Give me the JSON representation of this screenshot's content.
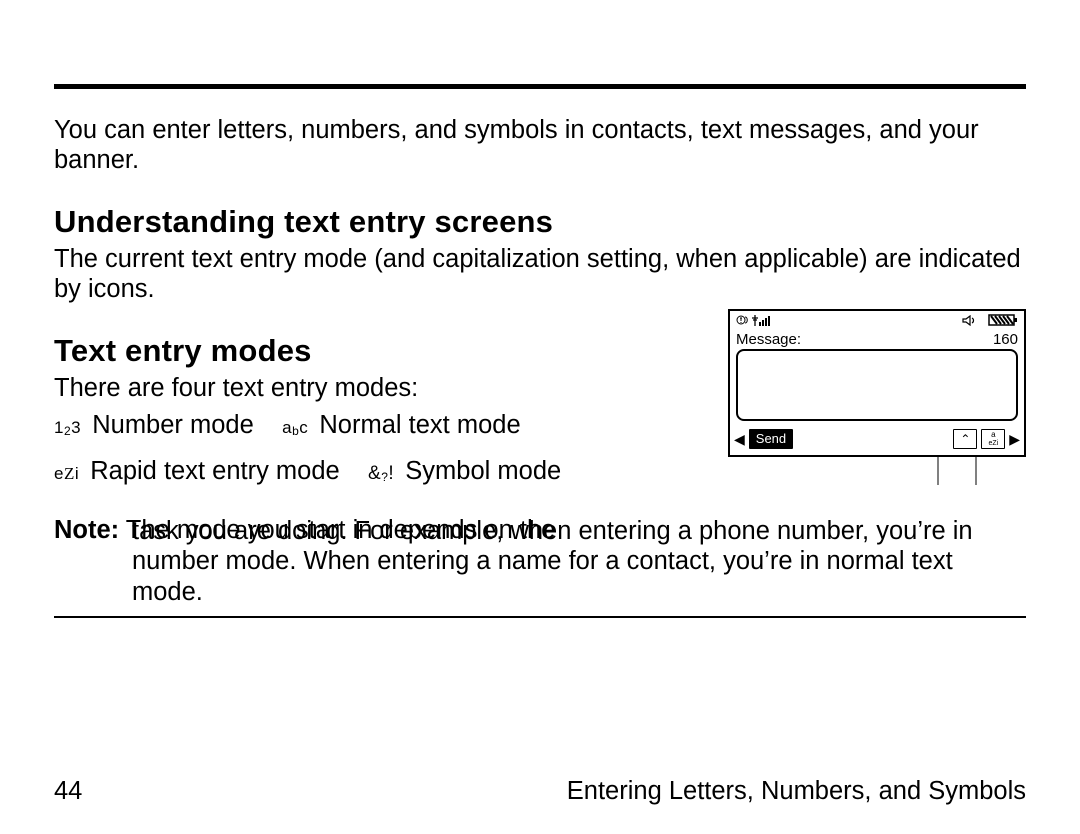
{
  "intro": "You can enter letters, numbers, and symbols in contacts, text messages, and your banner.",
  "h_understanding": "Understanding text entry screens",
  "p_understanding": "The current text entry mode (and capitalization setting, when applicable) are indicated by icons.",
  "h_modes": "Text entry modes",
  "p_modes_lead": "There are four text entry modes:",
  "modes": {
    "number_icon": "1₂3",
    "number_label": "Number mode",
    "normal_icon": "aᵦc",
    "normal_label": "Normal text mode",
    "rapid_icon": "eZi",
    "rapid_label": "Rapid text entry mode",
    "symbol_icon": "&?!",
    "symbol_label": "Symbol mode"
  },
  "note_label": "Note:",
  "note_body": "The mode you start in depends on the task you are doing. For example, when entering a phone number, you’re in number mode. When entering a name for a contact, you’re in normal text mode.",
  "phone": {
    "title": "Message:",
    "char_count": "160",
    "softkey_send": "Send",
    "mode_hint": "eZi"
  },
  "footer": {
    "page": "44",
    "chapter": "Entering Letters, Numbers, and Symbols"
  }
}
